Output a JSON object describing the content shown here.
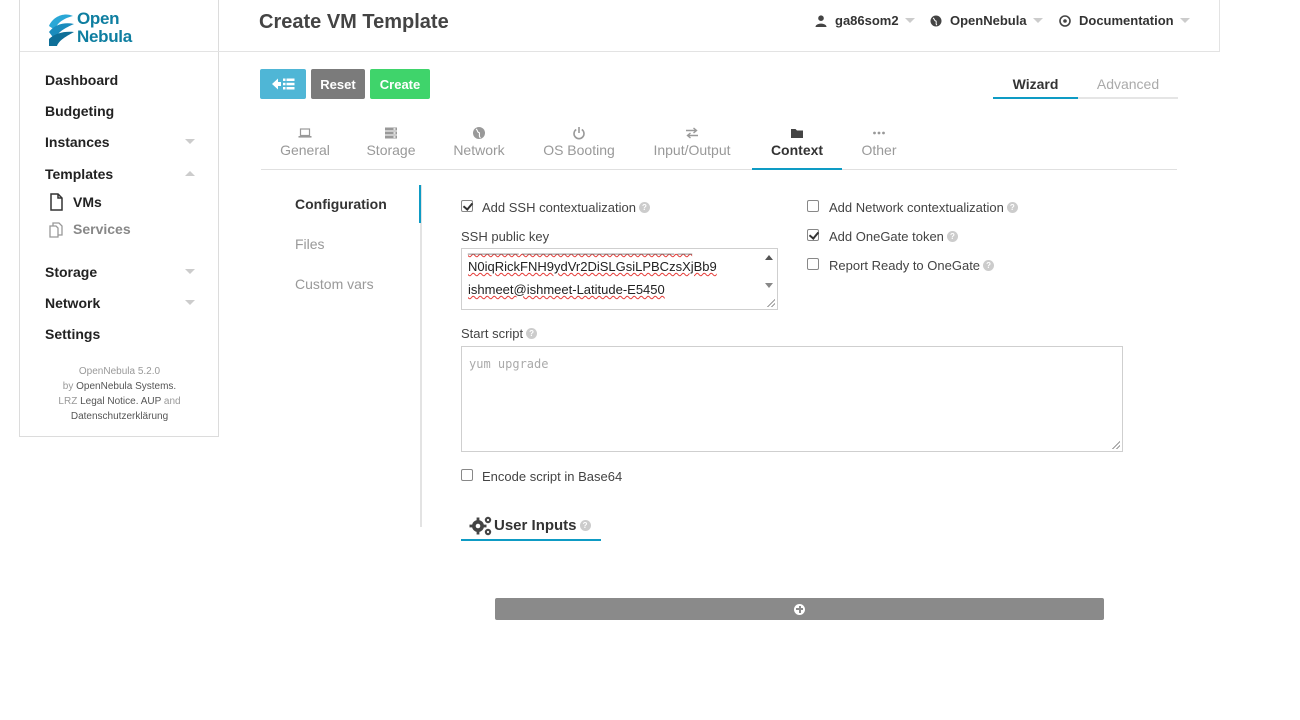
{
  "app": {
    "logo_line1": "Open",
    "logo_line2": "Nebula"
  },
  "header": {
    "title": "Create VM Template",
    "user": "ga86som2",
    "zone": "OpenNebula",
    "docs": "Documentation"
  },
  "sidebar": {
    "items": [
      {
        "label": "Dashboard"
      },
      {
        "label": "Budgeting"
      },
      {
        "label": "Instances"
      },
      {
        "label": "Templates"
      },
      {
        "label": "Storage"
      },
      {
        "label": "Network"
      },
      {
        "label": "Settings"
      }
    ],
    "templates_sub": [
      {
        "label": "VMs"
      },
      {
        "label": "Services"
      }
    ],
    "footer": {
      "version": "OpenNebula 5.2.0",
      "by": "by",
      "company": "OpenNebula Systems.",
      "lrz": "LRZ",
      "legal": "Legal Notice",
      "aup": "AUP",
      "and": "and",
      "privacy": "Datenschutzerklärung"
    }
  },
  "toolbar": {
    "reset_label": "Reset",
    "create_label": "Create",
    "wizard_label": "Wizard",
    "advanced_label": "Advanced"
  },
  "tabs": [
    {
      "label": "General",
      "icon": "laptop-icon"
    },
    {
      "label": "Storage",
      "icon": "storage-icon"
    },
    {
      "label": "Network",
      "icon": "globe-icon"
    },
    {
      "label": "OS Booting",
      "icon": "power-icon"
    },
    {
      "label": "Input/Output",
      "icon": "exchange-icon"
    },
    {
      "label": "Context",
      "icon": "folder-icon"
    },
    {
      "label": "Other",
      "icon": "ellipsis-icon"
    }
  ],
  "context": {
    "subtabs": [
      {
        "label": "Configuration"
      },
      {
        "label": "Files"
      },
      {
        "label": "Custom vars"
      }
    ],
    "add_ssh": {
      "label": "Add SSH contextualization",
      "checked": true
    },
    "ssh_key_label": "SSH public key",
    "ssh_key_lines": [
      "N0iqRickFNH9ydVr2DiSLGsiLPBCzsXjBb9",
      "ishmeet@ishmeet-Latitude-E5450"
    ],
    "add_network": {
      "label": "Add Network contextualization",
      "checked": false
    },
    "add_onegate": {
      "label": "Add OneGate token",
      "checked": true
    },
    "report_ready": {
      "label": "Report Ready to OneGate",
      "checked": false
    },
    "start_script_label": "Start script",
    "start_script_placeholder": "yum upgrade",
    "encode_base64": {
      "label": "Encode script in Base64",
      "checked": false
    },
    "user_inputs_title": "User Inputs"
  },
  "colors": {
    "accent": "#0e9bc4",
    "back_button": "#4fb6d6",
    "reset_button": "#7b7b7b",
    "create_button": "#3fd46b",
    "brand": "#0e7ea0"
  }
}
